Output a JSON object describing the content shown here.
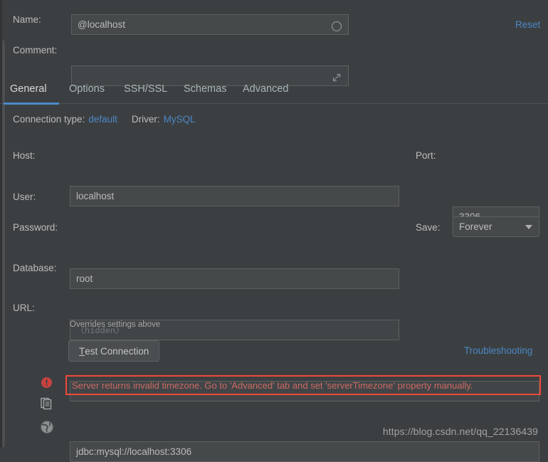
{
  "header": {
    "name_label": "Name:",
    "name_value": "@localhost",
    "name_icon": "circle-icon",
    "comment_label": "Comment:",
    "comment_value": "",
    "comment_icon": "expand-diagonal-icon",
    "reset_label": "Reset"
  },
  "tabs": [
    {
      "label": "General",
      "active": true
    },
    {
      "label": "Options",
      "active": false
    },
    {
      "label": "SSH/SSL",
      "active": false
    },
    {
      "label": "Schemas",
      "active": false
    },
    {
      "label": "Advanced",
      "active": false
    }
  ],
  "connection_info": {
    "type_label": "Connection type:",
    "type_value": "default",
    "driver_label": "Driver:",
    "driver_value": "MySQL"
  },
  "form": {
    "host_label": "Host:",
    "host_value": "localhost",
    "port_label": "Port:",
    "port_value": "3306",
    "user_label": "User:",
    "user_value": "root",
    "password_label": "Password:",
    "password_placeholder": "〈hidden〉",
    "save_label": "Save:",
    "save_value": "Forever",
    "database_label": "Database:",
    "database_value": "",
    "url_label": "URL:",
    "url_value": "jdbc:mysql://localhost:3306",
    "url_hint": "Overrides settings above"
  },
  "actions": {
    "test_connection_mnemonic": "T",
    "test_connection_label": "est Connection",
    "troubleshooting_label": "Troubleshooting"
  },
  "status": {
    "error_icon": "error-circle-icon",
    "error_message": "Server returns invalid timezone. Go to 'Advanced' tab and set 'serverTimezone' property manually."
  },
  "side_icons": [
    {
      "name": "copy-icon"
    },
    {
      "name": "globe-icon"
    }
  ],
  "watermark": "https://blog.csdn.net/qq_22136439",
  "colors": {
    "background": "#3c3f41",
    "field_background": "#45494a",
    "field_border": "#5e6060",
    "accent_link": "#4a88c7",
    "error_border": "#f0493a",
    "error_text": "#cd6a63",
    "text": "#bbbbbb"
  }
}
